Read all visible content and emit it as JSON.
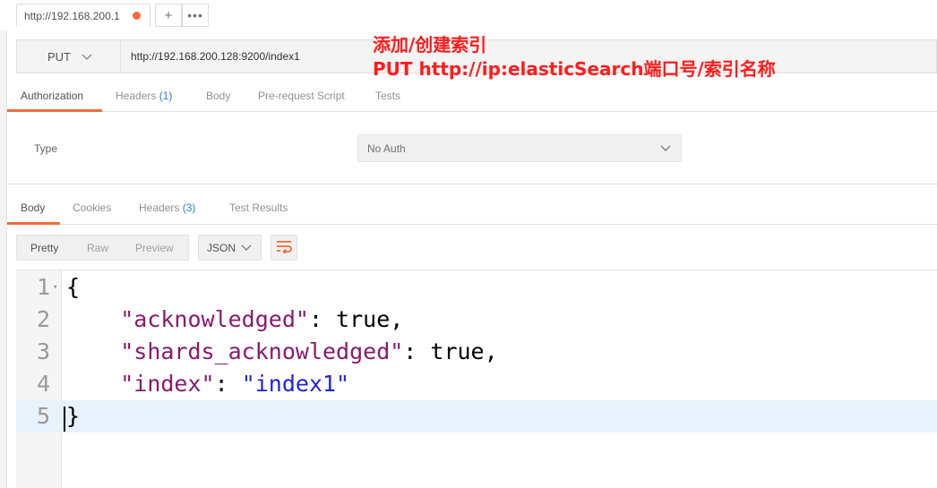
{
  "tab": {
    "title": "http://192.168.200.1",
    "add_label": "+",
    "more_label": "•••"
  },
  "request": {
    "method": "PUT",
    "url": "http://192.168.200.128:9200/index1"
  },
  "annotation": {
    "line1": "添加/创建索引",
    "line2": "PUT http://ip:elasticSearch端口号/索引名称"
  },
  "request_tabs": [
    {
      "label": "Authorization",
      "count": "",
      "active": true
    },
    {
      "label": "Headers",
      "count": "(1)",
      "active": false
    },
    {
      "label": "Body",
      "count": "",
      "active": false
    },
    {
      "label": "Pre-request Script",
      "count": "",
      "active": false
    },
    {
      "label": "Tests",
      "count": "",
      "active": false
    }
  ],
  "auth": {
    "type_label": "Type",
    "type_value": "No Auth"
  },
  "response_tabs": [
    {
      "label": "Body",
      "count": "",
      "active": true
    },
    {
      "label": "Cookies",
      "count": "",
      "active": false
    },
    {
      "label": "Headers",
      "count": "(3)",
      "active": false
    },
    {
      "label": "Test Results",
      "count": "",
      "active": false
    }
  ],
  "view_modes": [
    "Pretty",
    "Raw",
    "Preview"
  ],
  "format": "JSON",
  "code_lines": [
    {
      "n": "1",
      "text": "{"
    },
    {
      "n": "2",
      "key": "\"acknowledged\"",
      "sep": ": ",
      "val": "true",
      "tail": ","
    },
    {
      "n": "3",
      "key": "\"shards_acknowledged\"",
      "sep": ": ",
      "val": "true",
      "tail": ","
    },
    {
      "n": "4",
      "key": "\"index\"",
      "sep": ": ",
      "str": "\"index1\"",
      "tail": ""
    },
    {
      "n": "5",
      "text": "}"
    }
  ],
  "colors": {
    "accent": "#f26b3a",
    "annotation": "#ff1c1c",
    "link_count": "#2b78d8",
    "json_key": "#8a1a6b",
    "json_string": "#2222dd"
  },
  "icons": [
    "chevron-down-icon",
    "wrap-lines-icon"
  ]
}
